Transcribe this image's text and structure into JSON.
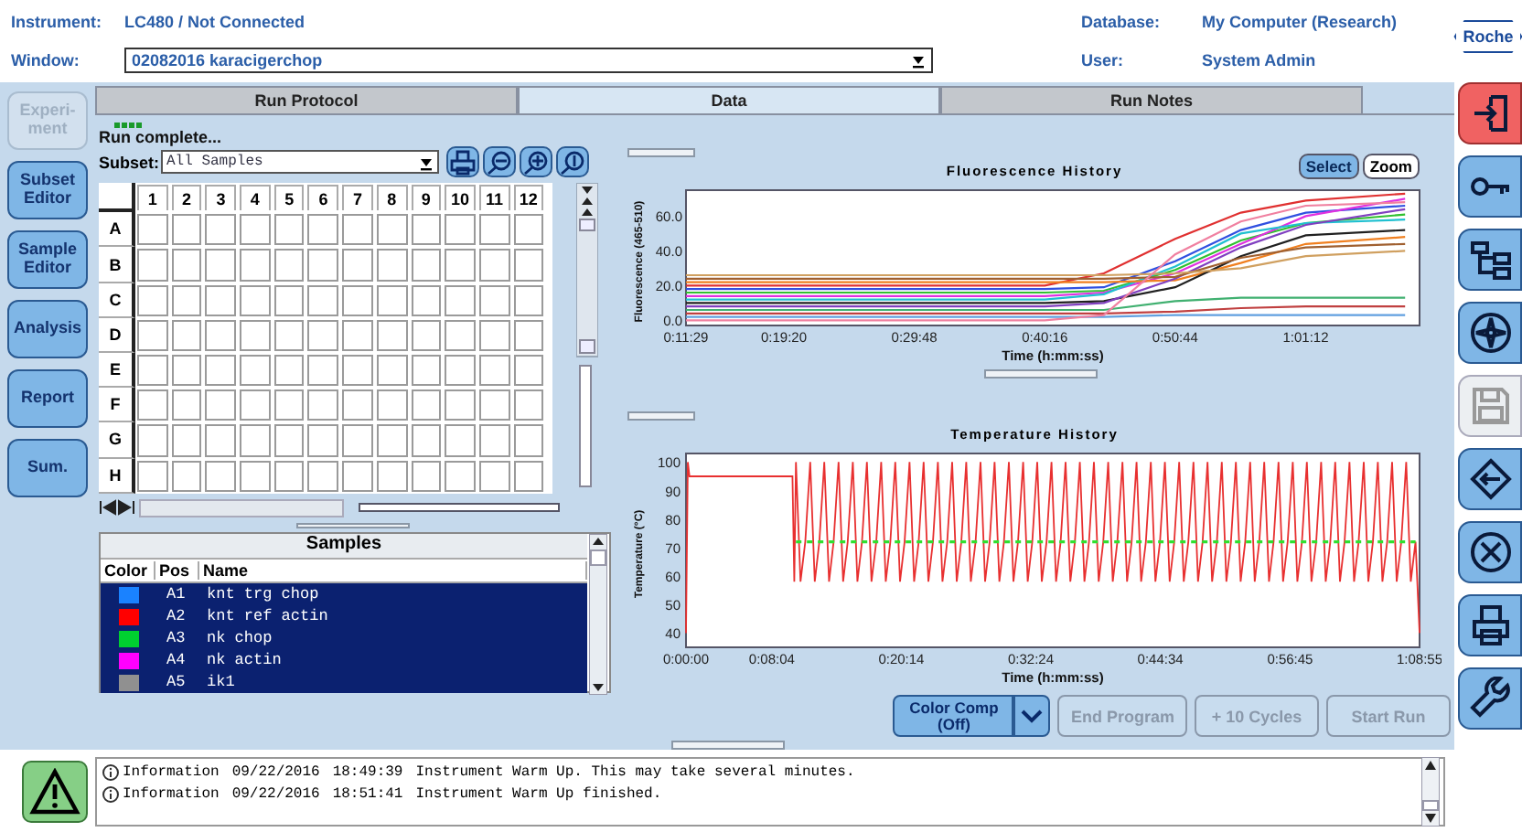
{
  "header": {
    "instrument_label": "Instrument:",
    "instrument": "LC480 / Not Connected",
    "window_label": "Window:",
    "window": "02082016 karacigerchop",
    "database_label": "Database:",
    "database": "My Computer (Research)",
    "user_label": "User:",
    "user": "System Admin",
    "logo": "Roche"
  },
  "nav": [
    {
      "label": "Experi-ment",
      "disabled": true,
      "selected": false
    },
    {
      "label": "Subset Editor",
      "disabled": false,
      "selected": false
    },
    {
      "label": "Sample Editor",
      "disabled": false,
      "selected": false
    },
    {
      "label": "Analysis",
      "disabled": false,
      "selected": false
    },
    {
      "label": "Report",
      "disabled": false,
      "selected": false
    },
    {
      "label": "Sum.",
      "disabled": false,
      "selected": false
    }
  ],
  "tabs": [
    {
      "label": "Run Protocol",
      "selected": false
    },
    {
      "label": "Data",
      "selected": true
    },
    {
      "label": "Run Notes",
      "selected": false
    }
  ],
  "run_status": "Run complete...",
  "subset": {
    "label": "Subset:",
    "value": "All Samples"
  },
  "plate": {
    "columns": [
      "1",
      "2",
      "3",
      "4",
      "5",
      "6",
      "7",
      "8",
      "9",
      "10",
      "11",
      "12"
    ],
    "rows": [
      "A",
      "B",
      "C",
      "D",
      "E",
      "F",
      "G",
      "H"
    ]
  },
  "samples": {
    "title": "Samples",
    "columns": [
      "Color",
      "Pos",
      "Name"
    ],
    "rows": [
      {
        "color": "#1a82ff",
        "pos": "A1",
        "name": "knt trg chop",
        "selected": true
      },
      {
        "color": "#ff0000",
        "pos": "A2",
        "name": "knt ref actin",
        "selected": true
      },
      {
        "color": "#00d030",
        "pos": "A3",
        "name": "nk chop",
        "selected": true
      },
      {
        "color": "#ff00ff",
        "pos": "A4",
        "name": "nk actin",
        "selected": true
      },
      {
        "color": "#909090",
        "pos": "A5",
        "name": "ik1",
        "selected": true
      }
    ]
  },
  "fluorescence": {
    "title": "Fluorescence History",
    "buttons": [
      {
        "label": "Select",
        "selected": true
      },
      {
        "label": "Zoom",
        "selected": false
      }
    ],
    "chart_data": {
      "type": "line",
      "xlabel": "Time (h:mm:ss)",
      "ylabel": "Fluorescence (465-510)",
      "x": [
        689,
        1160,
        1788,
        2416,
        2700,
        3044,
        3360,
        3672,
        4150
      ],
      "xlim": [
        689,
        4220
      ],
      "ylim": [
        -3,
        75
      ],
      "xticks": [
        {
          "value": 689,
          "label": "0:11:29"
        },
        {
          "value": 1160,
          "label": "0:19:20"
        },
        {
          "value": 1788,
          "label": "0:29:48"
        },
        {
          "value": 2416,
          "label": "0:40:16"
        },
        {
          "value": 3044,
          "label": "0:50:44"
        },
        {
          "value": 3672,
          "label": "1:01:12"
        }
      ],
      "yticks": [
        {
          "value": 0,
          "label": "0.0"
        },
        {
          "value": 20,
          "label": "20.0"
        },
        {
          "value": 40,
          "label": "40.0"
        },
        {
          "value": 60,
          "label": "60.0"
        }
      ],
      "series": [
        {
          "color": "#e03030",
          "values": [
            20,
            20,
            20,
            20,
            27,
            47,
            62,
            69,
            73
          ]
        },
        {
          "color": "#3050e0",
          "values": [
            18,
            18,
            18,
            18,
            19,
            34,
            52,
            62,
            66
          ]
        },
        {
          "color": "#30c030",
          "values": [
            16,
            16,
            16,
            16,
            17,
            29,
            46,
            56,
            61
          ]
        },
        {
          "color": "#e030e0",
          "values": [
            14,
            14,
            14,
            14,
            16,
            27,
            44,
            60,
            70
          ]
        },
        {
          "color": "#20c0d0",
          "values": [
            12,
            12,
            12,
            12,
            15,
            31,
            50,
            56,
            58
          ]
        },
        {
          "color": "#f08020",
          "values": [
            22,
            22,
            22,
            22,
            22,
            23,
            33,
            44,
            48
          ]
        },
        {
          "color": "#202020",
          "values": [
            10,
            10,
            10,
            10,
            11,
            19,
            37,
            49,
            52
          ]
        },
        {
          "color": "#8040c0",
          "values": [
            8,
            8,
            8,
            8,
            10,
            24,
            42,
            55,
            64
          ]
        },
        {
          "color": "#a06030",
          "values": [
            24,
            24,
            24,
            24,
            24,
            25,
            36,
            42,
            44
          ]
        },
        {
          "color": "#40b070",
          "values": [
            6,
            6,
            6,
            6,
            6,
            11,
            13,
            13,
            13
          ]
        },
        {
          "color": "#c04040",
          "values": [
            4,
            4,
            4,
            4,
            4,
            5,
            7,
            8,
            8
          ]
        },
        {
          "color": "#60a0e0",
          "values": [
            2,
            2,
            2,
            2,
            2,
            3,
            3,
            3,
            3
          ]
        },
        {
          "color": "#d0a060",
          "values": [
            26,
            26,
            26,
            26,
            26,
            27,
            30,
            37,
            40
          ]
        },
        {
          "color": "#f080a0",
          "values": [
            0,
            0,
            0,
            0,
            3,
            38,
            57,
            66,
            68
          ]
        }
      ]
    }
  },
  "temperature": {
    "title": "Temperature History",
    "chart_data": {
      "type": "line",
      "xlabel": "Time (h:mm:ss)",
      "ylabel": "Temperature (°C)",
      "xlim": [
        0,
        4135
      ],
      "ylim": [
        35,
        103
      ],
      "xticks": [
        {
          "value": 0,
          "label": "0:00:00"
        },
        {
          "value": 484,
          "label": "0:08:04"
        },
        {
          "value": 1214,
          "label": "0:20:14"
        },
        {
          "value": 1944,
          "label": "0:32:24"
        },
        {
          "value": 2674,
          "label": "0:44:34"
        },
        {
          "value": 3405,
          "label": "0:56:45"
        },
        {
          "value": 4135,
          "label": "1:08:55"
        }
      ],
      "yticks": [
        40,
        50,
        60,
        70,
        80,
        90,
        100
      ],
      "x": [
        0,
        10,
        20,
        600,
        610,
        620,
        646,
        672,
        700,
        726,
        752,
        780,
        806,
        832,
        860,
        886,
        912,
        940,
        966,
        992,
        1020,
        1046,
        1072,
        1100,
        1126,
        1152,
        1180,
        1206,
        1232,
        1260,
        1286,
        1312,
        1340,
        1366,
        1392,
        1420,
        1446,
        1472,
        1500,
        1526,
        1552,
        1580,
        1606,
        1632,
        1660,
        1686,
        1712,
        1740,
        1766,
        1792,
        1820,
        1846,
        1872,
        1900,
        1926,
        1952,
        1980,
        2006,
        2032,
        2060,
        2086,
        2112,
        2140,
        2166,
        2192,
        2220,
        2246,
        2272,
        2300,
        2326,
        2352,
        2380,
        2406,
        2432,
        2460,
        2486,
        2512,
        2540,
        2566,
        2592,
        2620,
        2646,
        2672,
        2700,
        2726,
        2752,
        2780,
        2806,
        2832,
        2860,
        2886,
        2912,
        2940,
        2966,
        2992,
        3020,
        3046,
        3072,
        3100,
        3126,
        3152,
        3180,
        3206,
        3232,
        3260,
        3286,
        3312,
        3340,
        3366,
        3392,
        3420,
        3446,
        3472,
        3500,
        3526,
        3552,
        3580,
        3606,
        3632,
        3660,
        3686,
        3712,
        3740,
        3766,
        3792,
        3820,
        3846,
        3872,
        3900,
        3926,
        3952,
        3980,
        4006,
        4032,
        4060,
        4086,
        4112,
        4135
      ],
      "series": [
        {
          "color": "#e83030",
          "values": [
            40,
            100,
            95,
            95,
            58,
            100,
            58,
            72,
            100,
            58,
            72,
            100,
            58,
            72,
            100,
            58,
            72,
            100,
            58,
            72,
            100,
            58,
            72,
            100,
            58,
            72,
            100,
            58,
            72,
            100,
            58,
            72,
            100,
            58,
            72,
            100,
            58,
            72,
            100,
            58,
            72,
            100,
            58,
            72,
            100,
            58,
            72,
            100,
            58,
            72,
            100,
            58,
            72,
            100,
            58,
            72,
            100,
            58,
            72,
            100,
            58,
            72,
            100,
            58,
            72,
            100,
            58,
            72,
            100,
            58,
            72,
            100,
            58,
            72,
            100,
            58,
            72,
            100,
            58,
            72,
            100,
            58,
            72,
            100,
            58,
            72,
            100,
            58,
            72,
            100,
            58,
            72,
            100,
            58,
            72,
            100,
            58,
            72,
            100,
            58,
            72,
            100,
            58,
            72,
            100,
            58,
            72,
            100,
            58,
            72,
            100,
            58,
            72,
            100,
            58,
            72,
            100,
            58,
            72,
            100,
            58,
            72,
            100,
            58,
            72,
            100,
            58,
            72,
            100,
            58,
            72,
            100,
            58,
            72,
            100,
            58,
            72,
            40
          ]
        },
        {
          "color": "#30e030",
          "line_style": "dashed",
          "values": [
            null,
            null,
            null,
            null,
            null,
            72,
            72,
            72,
            72,
            72,
            72,
            72,
            72,
            72,
            72,
            72,
            72,
            72,
            72,
            72,
            72,
            72,
            72,
            72,
            72,
            72,
            72,
            72,
            72,
            72,
            72,
            72,
            72,
            72,
            72,
            72,
            72,
            72,
            72,
            72,
            72,
            72,
            72,
            72,
            72,
            72,
            72,
            72,
            72,
            72,
            72,
            72,
            72,
            72,
            72,
            72,
            72,
            72,
            72,
            72,
            72,
            72,
            72,
            72,
            72,
            72,
            72,
            72,
            72,
            72,
            72,
            72,
            72,
            72,
            72,
            72,
            72,
            72,
            72,
            72,
            72,
            72,
            72,
            72,
            72,
            72,
            72,
            72,
            72,
            72,
            72,
            72,
            72,
            72,
            72,
            72,
            72,
            72,
            72,
            72,
            72,
            72,
            72,
            72,
            72,
            72,
            72,
            72,
            72,
            72,
            72,
            72,
            72,
            72,
            72,
            72,
            72,
            72,
            72,
            72,
            72,
            72,
            72,
            72,
            72,
            72,
            72,
            72,
            72,
            72,
            72,
            72,
            72,
            72,
            72,
            72,
            72,
            null
          ]
        }
      ]
    }
  },
  "actions": [
    {
      "label": "Color Comp (Off)",
      "kind": "split",
      "disabled": false
    },
    {
      "label": "End Program",
      "kind": "button",
      "disabled": true
    },
    {
      "label": "+ 10 Cycles",
      "kind": "button",
      "disabled": true
    },
    {
      "label": "Start Run",
      "kind": "button",
      "disabled": true
    }
  ],
  "toolbar": [
    {
      "kind": "exit",
      "disabled": false
    },
    {
      "kind": "key",
      "disabled": false
    },
    {
      "kind": "tree",
      "disabled": false
    },
    {
      "kind": "compass",
      "disabled": false
    },
    {
      "kind": "save",
      "disabled": true
    },
    {
      "kind": "diamond",
      "disabled": false
    },
    {
      "kind": "close",
      "disabled": false
    },
    {
      "kind": "print",
      "disabled": false
    },
    {
      "kind": "wrench",
      "disabled": false
    }
  ],
  "log": [
    {
      "type": "Information",
      "date": "09/22/2016",
      "time": "18:49:39",
      "message": "Instrument Warm Up. This may take several minutes."
    },
    {
      "type": "Information",
      "date": "09/22/2016",
      "time": "18:51:41",
      "message": "Instrument Warm Up finished."
    }
  ]
}
